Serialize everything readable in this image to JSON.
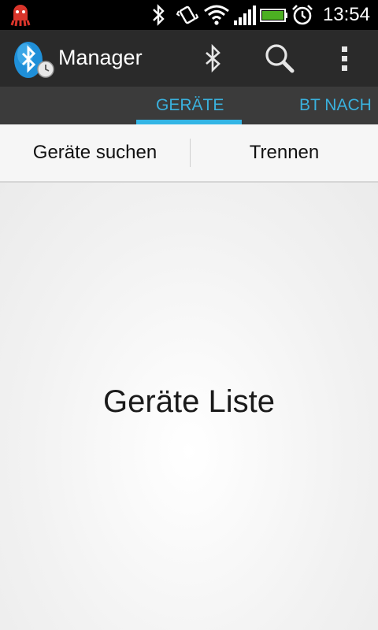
{
  "status_bar": {
    "time": "13:54",
    "icons": [
      "notification-octopus-icon",
      "bluetooth-icon",
      "vibrate-icon",
      "wifi-icon",
      "signal-icon",
      "battery-icon",
      "alarm-icon"
    ],
    "battery_level": 1.0,
    "battery_color": "#4caf22"
  },
  "action_bar": {
    "title": "Manager",
    "icons": [
      "bluetooth-app-icon",
      "bluetooth-icon",
      "search-icon",
      "overflow-menu-icon"
    ]
  },
  "tabs": [
    {
      "label": "GERÄTE",
      "selected": true
    },
    {
      "label": "BT NACH",
      "selected": false
    }
  ],
  "accent_color": "#33b5e5",
  "buttons": {
    "search_devices": "Geräte suchen",
    "disconnect": "Trennen"
  },
  "content": {
    "placeholder": "Geräte Liste"
  }
}
